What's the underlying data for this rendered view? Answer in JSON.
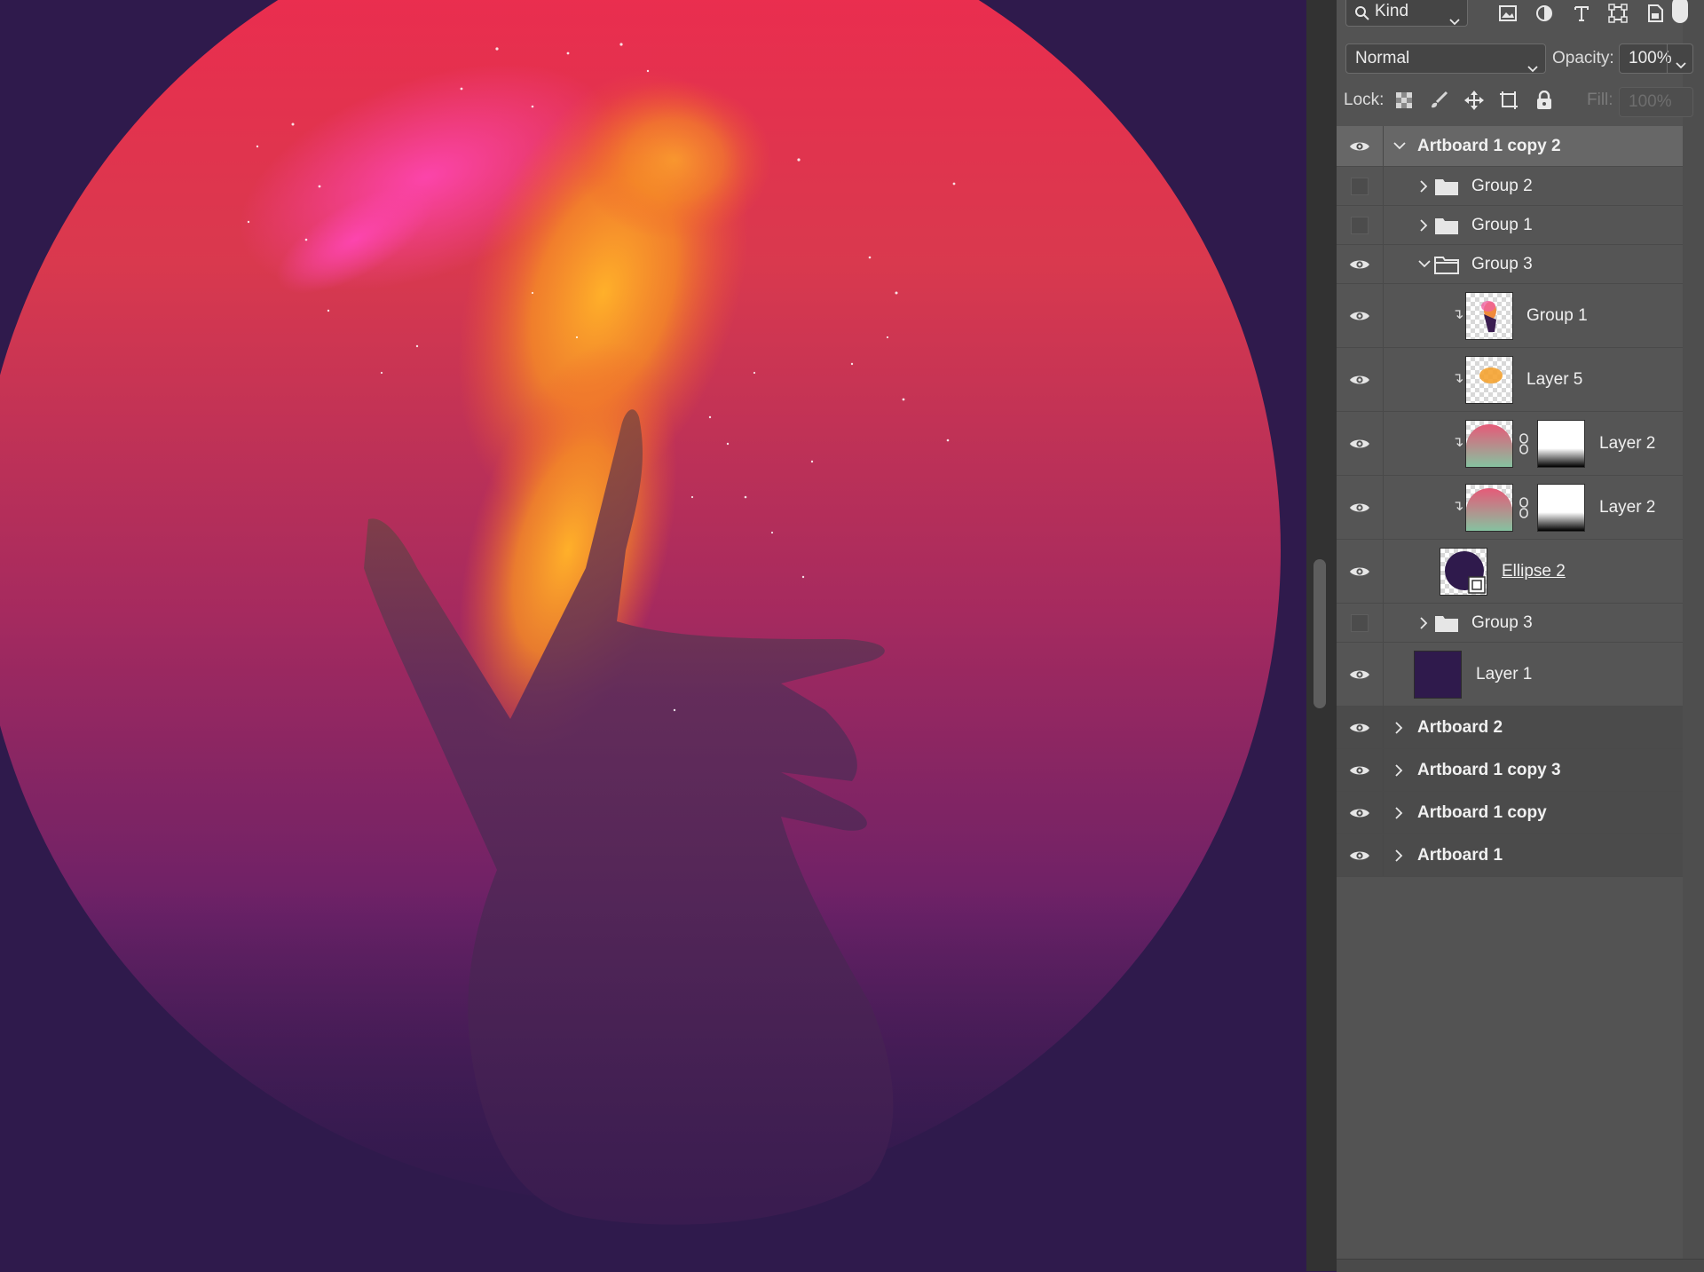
{
  "filter": {
    "kind_label": "Kind",
    "icons": [
      "image-filter-icon",
      "adjustment-filter-icon",
      "type-filter-icon",
      "shape-filter-icon",
      "smart-object-filter-icon"
    ]
  },
  "blend": {
    "mode": "Normal",
    "opacity_label": "Opacity:",
    "opacity_value": "100%"
  },
  "lock": {
    "label": "Lock:",
    "fill_label": "Fill:",
    "fill_value": "100%"
  },
  "layers": [
    {
      "name": "Artboard 1 copy 2",
      "kind": "artboard",
      "visible": true,
      "expanded": true,
      "selected": true
    },
    {
      "name": "Group 2",
      "kind": "group",
      "visible": false,
      "expanded": false
    },
    {
      "name": "Group 1",
      "kind": "group",
      "visible": false,
      "expanded": false
    },
    {
      "name": "Group 3",
      "kind": "group",
      "visible": true,
      "expanded": true
    },
    {
      "name": "Group 1",
      "kind": "smart",
      "visible": true,
      "clipped": true
    },
    {
      "name": "Layer 5",
      "kind": "pixel",
      "visible": true,
      "clipped": true
    },
    {
      "name": "Layer 2",
      "kind": "pixel-mask",
      "visible": true,
      "clipped": true
    },
    {
      "name": "Layer 2",
      "kind": "pixel-mask",
      "visible": true,
      "clipped": true
    },
    {
      "name": "Ellipse 2",
      "kind": "shape",
      "visible": true
    },
    {
      "name": "Group 3",
      "kind": "group",
      "visible": false,
      "expanded": false
    },
    {
      "name": "Layer 1",
      "kind": "fill",
      "visible": true
    },
    {
      "name": "Artboard 2",
      "kind": "artboard",
      "visible": true,
      "expanded": false
    },
    {
      "name": "Artboard 1 copy 3",
      "kind": "artboard",
      "visible": true,
      "expanded": false
    },
    {
      "name": "Artboard 1 copy",
      "kind": "artboard",
      "visible": true,
      "expanded": false
    },
    {
      "name": "Artboard 1",
      "kind": "artboard",
      "visible": true,
      "expanded": false
    }
  ],
  "colors": {
    "panel_bg": "#535353",
    "canvas_bg": "#2f1a4c",
    "selected_row": "#676767"
  }
}
